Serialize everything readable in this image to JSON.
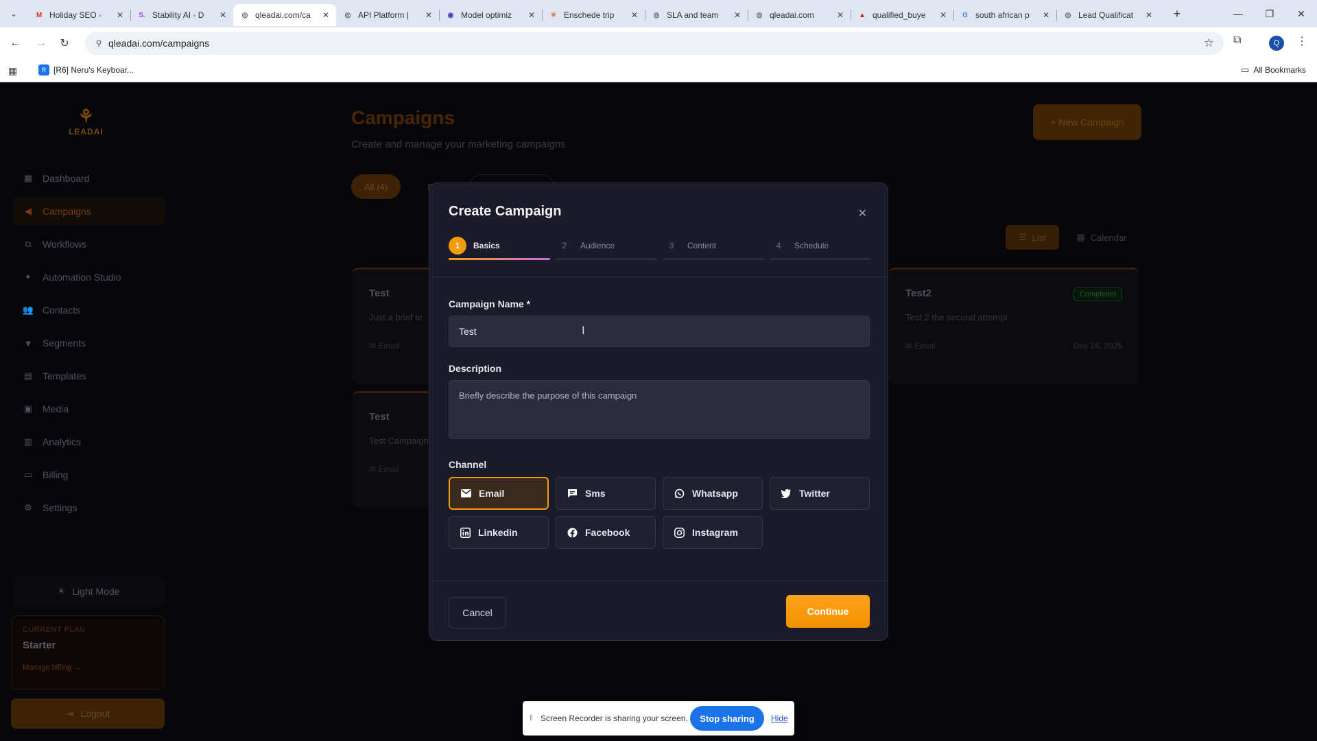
{
  "browser": {
    "tabs": [
      {
        "label": "Holiday SEO -",
        "favicon": "M",
        "fav_color": "#d93025"
      },
      {
        "label": "Stability AI - D",
        "favicon": "S.",
        "fav_color": "#a142f4"
      },
      {
        "label": "qleadai.com/ca",
        "favicon": "◎",
        "fav_color": "#555555"
      },
      {
        "label": "API Platform |",
        "favicon": "◎",
        "fav_color": "#555555"
      },
      {
        "label": "Model optimiz",
        "favicon": "◉",
        "fav_color": "#3c3cc8"
      },
      {
        "label": "Enschede trip",
        "favicon": "✳",
        "fav_color": "#d96a4a"
      },
      {
        "label": "SLA and team",
        "favicon": "◎",
        "fav_color": "#555555"
      },
      {
        "label": "qleadai.com",
        "favicon": "◎",
        "fav_color": "#555555"
      },
      {
        "label": "qualified_buye",
        "favicon": "▲",
        "fav_color": "#c5221f"
      },
      {
        "label": "south african p",
        "favicon": "G",
        "fav_color": "#4285f4"
      },
      {
        "label": "Lead Qualificat",
        "favicon": "◎",
        "fav_color": "#555555"
      }
    ],
    "url": "qleadai.com/campaigns",
    "profile_initial": "Q",
    "bookmark": "[R6] Neru's Keyboar...",
    "all_bookmarks": "All Bookmarks"
  },
  "sidebar": {
    "logo_text": "LEADAI",
    "items": [
      {
        "label": "Dashboard",
        "icon": "dashboard-icon",
        "glyph": "▦"
      },
      {
        "label": "Campaigns",
        "icon": "megaphone-icon",
        "glyph": "◀",
        "active": true
      },
      {
        "label": "Workflows",
        "icon": "workflow-icon",
        "glyph": "⧉"
      },
      {
        "label": "Automation Studio",
        "icon": "sparkle-icon",
        "glyph": "✦"
      },
      {
        "label": "Contacts",
        "icon": "users-icon",
        "glyph": "👥"
      },
      {
        "label": "Segments",
        "icon": "filter-icon",
        "glyph": "▼"
      },
      {
        "label": "Templates",
        "icon": "template-icon",
        "glyph": "▤"
      },
      {
        "label": "Media",
        "icon": "media-icon",
        "glyph": "▣"
      },
      {
        "label": "Analytics",
        "icon": "chart-icon",
        "glyph": "▥"
      },
      {
        "label": "Billing",
        "icon": "card-icon",
        "glyph": "▭"
      },
      {
        "label": "Settings",
        "icon": "gear-icon",
        "glyph": "⚙"
      }
    ],
    "light_mode": "Light Mode",
    "plan_label": "CURRENT PLAN",
    "plan_name": "Starter",
    "manage_billing": "Manage billing →",
    "logout": "Logout"
  },
  "page": {
    "title": "Campaigns",
    "subtitle": "Create and manage your marketing campaigns",
    "new_campaign": "+ New Campaign",
    "filter_all": "All (4)",
    "filter_draft": "Dr",
    "view_list": "List",
    "view_calendar": "Calendar",
    "cards": [
      {
        "title": "Test",
        "desc": "Just a brief te",
        "channel": "Email",
        "date": "",
        "badge": ""
      },
      {
        "title": "Test2",
        "desc": "Test 2 the second attempt",
        "channel": "Email",
        "date": "Dec 16, 2025",
        "badge": "Completed"
      },
      {
        "title": "Test",
        "desc": "Test Campaign",
        "channel": "Email",
        "date": "",
        "badge": ""
      }
    ]
  },
  "modal": {
    "title": "Create Campaign",
    "steps": [
      {
        "num": "1",
        "label": "Basics",
        "active": true
      },
      {
        "num": "2",
        "label": "Audience",
        "active": false
      },
      {
        "num": "3",
        "label": "Content",
        "active": false
      },
      {
        "num": "4",
        "label": "Schedule",
        "active": false
      }
    ],
    "name_label": "Campaign Name *",
    "name_value": "Test",
    "desc_label": "Description",
    "desc_placeholder": "Briefly describe the purpose of this campaign",
    "channel_label": "Channel",
    "channels": [
      {
        "label": "Email",
        "icon": "mail-icon",
        "selected": true
      },
      {
        "label": "Sms",
        "icon": "chat-icon",
        "selected": false
      },
      {
        "label": "Whatsapp",
        "icon": "whatsapp-icon",
        "selected": false
      },
      {
        "label": "Twitter",
        "icon": "twitter-icon",
        "selected": false
      },
      {
        "label": "Linkedin",
        "icon": "linkedin-icon",
        "selected": false
      },
      {
        "label": "Facebook",
        "icon": "facebook-icon",
        "selected": false
      },
      {
        "label": "Instagram",
        "icon": "instagram-icon",
        "selected": false
      }
    ],
    "cancel": "Cancel",
    "continue": "Continue"
  },
  "share_bar": {
    "message": "Screen Recorder is sharing your screen.",
    "stop": "Stop sharing",
    "hide": "Hide"
  },
  "colors": {
    "accent": "#f59a0a",
    "modal_bg": "#1b1b29",
    "share_blue": "#1a73e8"
  }
}
